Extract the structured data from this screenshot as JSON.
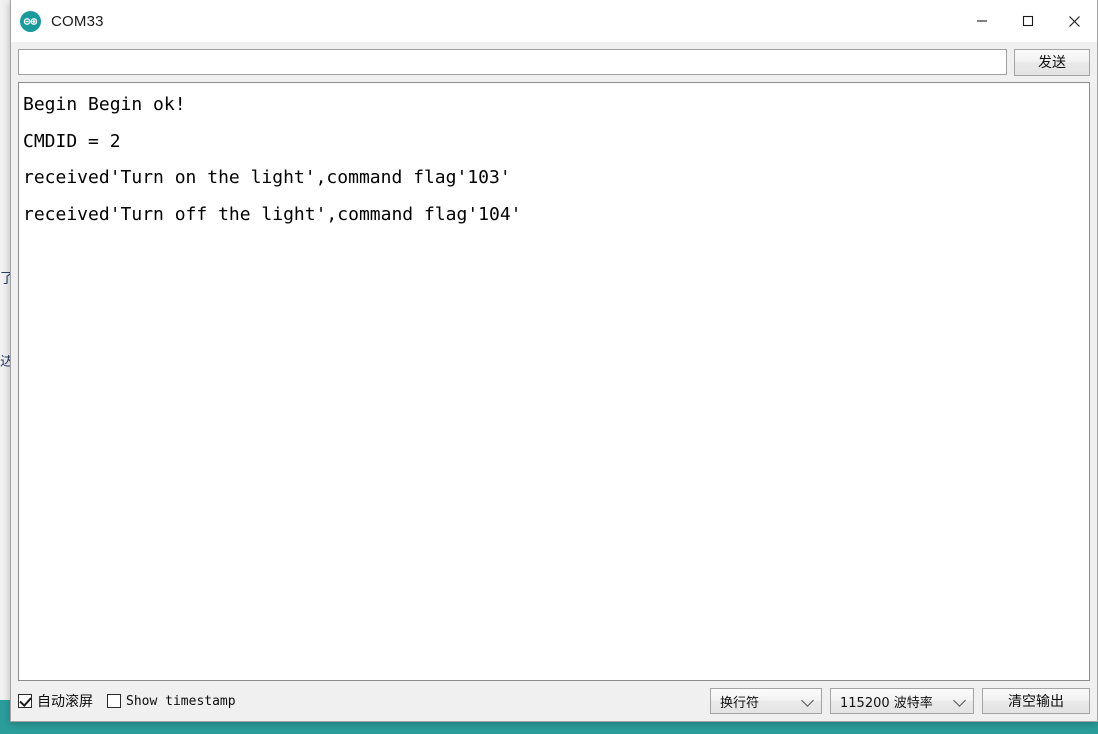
{
  "window": {
    "title": "COM33",
    "logo_icon": "arduino-logo-icon",
    "controls": {
      "minimize": "minimize-icon",
      "maximize": "maximize-icon",
      "close": "close-icon"
    }
  },
  "send_bar": {
    "input_value": "",
    "input_placeholder": "",
    "send_label": "发送"
  },
  "console": {
    "lines": [
      "Begin Begin ok!",
      "CMDID = 2",
      "received'Turn on the light',command flag'103'",
      "received'Turn off the light',command flag'104'"
    ],
    "text": "Begin Begin ok!\nCMDID = 2\nreceived'Turn on the light',command flag'103'\nreceived'Turn off the light',command flag'104'"
  },
  "bottom_bar": {
    "autoscroll_label": "自动滚屏",
    "autoscroll_checked": true,
    "timestamp_label": "Show timestamp",
    "timestamp_checked": false,
    "newline_value": "换行符",
    "baud_value": "115200 波特率",
    "clear_label": "清空输出"
  },
  "background": {
    "fragment_top": "了",
    "fragment_bottom": "达",
    "taskbar_color": "#2a9d9a"
  },
  "colors": {
    "accent_teal": "#1a9a9a",
    "window_chrome": "#f0f0f0",
    "console_bg": "#ffffff",
    "console_text": "#000000"
  }
}
